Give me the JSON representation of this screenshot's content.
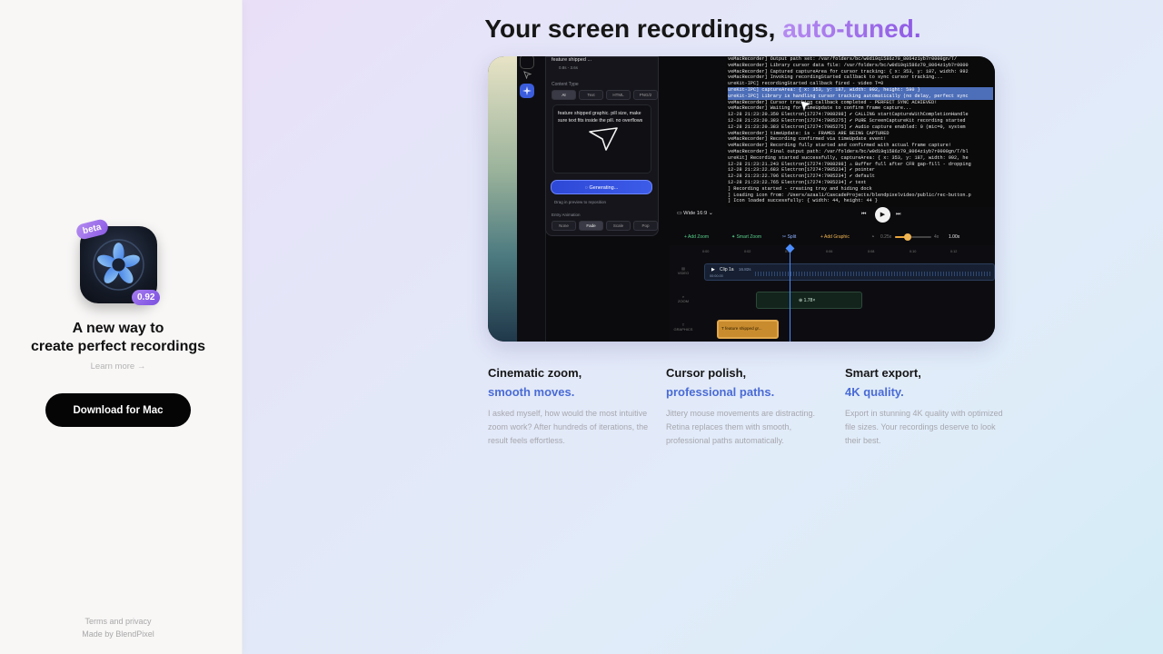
{
  "sidebar": {
    "beta_badge": "beta",
    "version_badge": "0.92",
    "tagline_line1": "A new way to",
    "tagline_line2": "create perfect recordings",
    "learn_more": "Learn more →",
    "download_label": "Download for Mac",
    "terms": "Terms and privacy",
    "made_by": "Made by BlendPixel"
  },
  "hero": {
    "headline_main": "Your screen recordings,",
    "headline_accent": "auto-tuned."
  },
  "screenshot": {
    "panel": {
      "header": "feature shipped ...",
      "header_sub": "0.8s - 3.6s",
      "content_type_label": "Content Type",
      "content_types": [
        "AI",
        "Text",
        "HTML",
        "PNG/2"
      ],
      "prompt_text": "feature shipped graphic. pill size, make sure text fits inside the pill. no overflows",
      "generate_label": "Generating...",
      "drag_hint": "Drag in preview to reposition",
      "entry_animation_label": "Entry Animation",
      "animations": [
        "None",
        "Fade",
        "Scale",
        "Pop"
      ]
    },
    "console_lines": [
      "veMacRecorder] Output path set: /var/folders/bc/w0d19q1586z79_8064z1yb7r0000gn/T/",
      "veMacRecorder] Library cursor data file: /var/folders/bc/w0d19q1586z79_8064z1yb7r0000",
      "veMacRecorder] Captured captureArea for cursor tracking: { x: 353, y: 187, width: 992",
      "veMacRecorder] Invoking recordingStarted callback to sync cursor tracking...",
      "ureKit-IPC] recordingStarted callback fired - video T=0",
      "ureKit-IPC] captureArea: { x: 353, y: 187, width: 992, height: 590 }",
      "ureKit-IPC] Library is handling cursor tracking automatically (no delay, perfect sync",
      "veMacRecorder] Cursor tracking callback completed - PERFECT SYNC ACHIEVED!",
      "veMacRecorder] Waiting for timeUpdate to confirm frame capture...",
      "12-28 21:23:20.350 Electron[17274:7908298] ✔ CALLING startCaptureWithCompletionHandle",
      "12-28 21:23:20.383 Electron[17274:7905275] ✔ PURE ScreenCaptureKit recording started",
      "12-28 21:23:20.383 Electron[17274:7905275] ✔ Audio capture enabled: 0 (mic=0, system",
      "veMacRecorder] timeUpdate: 1s - FRAMES ARE BEING CAPTURED",
      "veMacRecorder] Recording confirmed via timeUpdate event!",
      "veMacRecorder] Recording fully started and confirmed with actual frame capture!",
      "veMacRecorder] Final output path: /var/folders/bc/w0d19q1586z79_8064z1yb7r0000gn/T/bl",
      "ureKit] Recording started successfully, captureArea: { x: 353, y: 187, width: 992, he",
      "12-28 21:23:21.243 Electron[17274:7908298] ⚠ Buffer full after CFR gap-fill - dropping",
      "12-28 21:23:22.683 Electron[17274:7905234] ✔ pointer",
      "12-28 21:23:22.706 Electron[17274:7905234] ✔ default",
      "12-28 21:23:22.765 Electron[17274:7905234] ✔ text",
      "] Recording started - creating tray and hiding dock",
      "] Loading icon from: /Users/azaali/CascadeProjects/blendpixelvideo/public/rec-button.p",
      "] Icon loaded successfully: { width: 44, height: 44 }"
    ],
    "aspect_label": "Wide 16:9",
    "tools": {
      "add_zoom": "+ Add Zoom",
      "smart_zoom": "Smart Zoom",
      "split": "Split",
      "add_graphic": "+ Add Graphic",
      "speed_min": "0.25x",
      "speed_max": "4x",
      "speed_value": "1.00x"
    },
    "speed_level": 0.35,
    "ruler": [
      "0:00",
      "0:02",
      "0:04",
      "0:06",
      "0:08",
      "0:10",
      "0:12"
    ],
    "tracks": {
      "video": "VIDEO",
      "zoom": "ZOOM",
      "graphics": "GRAPHICS"
    },
    "clip_name": "Clip 1a",
    "clip_meta": "16.82s",
    "clip_time": "00:00.00",
    "zoom_clip_label": "1.78×",
    "graphic_clip_label": "feature shipped gr..."
  },
  "features": [
    {
      "title": "Cinematic zoom,",
      "subtitle": "smooth moves.",
      "desc": "I asked myself, how would the most intuitive zoom work? After hundreds of iterations, the result feels effortless."
    },
    {
      "title": "Cursor polish,",
      "subtitle": "professional paths.",
      "desc": "Jittery mouse movements are distracting. Retina replaces them with smooth, professional paths automatically."
    },
    {
      "title": "Smart export,",
      "subtitle": "4K quality.",
      "desc": "Export in stunning 4K quality with optimized file sizes. Your recordings deserve to look their best."
    }
  ]
}
